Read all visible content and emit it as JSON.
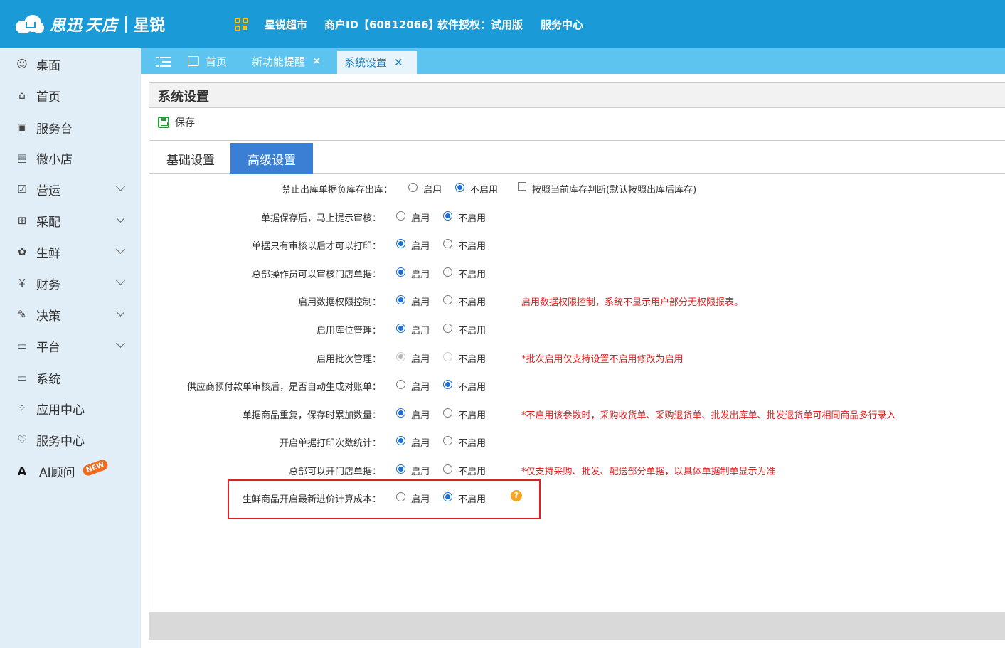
{
  "header": {
    "brand": "思迅",
    "brand_suffix": "天店",
    "product": "星锐",
    "store_name": "星锐超市",
    "merchant_id": "商户ID【60812066】",
    "license": "软件授权：试用版",
    "service": "服务中心",
    "colors": {
      "bar": "#1a9ad6",
      "qr": "#f5c518"
    }
  },
  "sidebar": {
    "items": [
      {
        "label": "桌面",
        "icon": "desktop-icon",
        "glyph": "☺",
        "has_chevron": false
      },
      {
        "label": "首页",
        "icon": "home-store-icon",
        "glyph": "⌂",
        "has_chevron": false
      },
      {
        "label": "服务台",
        "icon": "service-desk-icon",
        "glyph": "▣",
        "has_chevron": false
      },
      {
        "label": "微小店",
        "icon": "mini-store-icon",
        "glyph": "▤",
        "has_chevron": false
      },
      {
        "label": "营运",
        "icon": "operations-icon",
        "glyph": "☑",
        "has_chevron": true
      },
      {
        "label": "采配",
        "icon": "cart-icon",
        "glyph": "⊞",
        "has_chevron": true
      },
      {
        "label": "生鲜",
        "icon": "fresh-icon",
        "glyph": "✿",
        "has_chevron": true
      },
      {
        "label": "财务",
        "icon": "finance-icon",
        "glyph": "¥",
        "has_chevron": true
      },
      {
        "label": "决策",
        "icon": "decision-icon",
        "glyph": "✎",
        "has_chevron": true
      },
      {
        "label": "平台",
        "icon": "platform-icon",
        "glyph": "▭",
        "has_chevron": true
      },
      {
        "label": "系统",
        "icon": "system-icon",
        "glyph": "▭",
        "has_chevron": false
      },
      {
        "label": "应用中心",
        "icon": "app-center-icon",
        "glyph": "⁘",
        "has_chevron": false
      },
      {
        "label": "服务中心",
        "icon": "service-center-icon",
        "glyph": "♡",
        "has_chevron": false
      },
      {
        "label": "AI顾问",
        "icon": "ai-advisor-icon",
        "glyph": "A",
        "has_chevron": false,
        "badge": "NEW"
      }
    ]
  },
  "tabs": [
    {
      "label": "首页",
      "closable": false,
      "active": false
    },
    {
      "label": "新功能提醒",
      "closable": true,
      "active": false
    },
    {
      "label": "系统设置",
      "closable": true,
      "active": true
    }
  ],
  "tab_close_glyph": "✕",
  "page": {
    "title": "系统设置",
    "save_label": "保存",
    "subtabs": [
      {
        "label": "基础设置",
        "active": false
      },
      {
        "label": "高级设置",
        "active": true
      }
    ]
  },
  "options": {
    "enable": "启用",
    "disable": "不启用"
  },
  "settings": [
    {
      "label": "禁止出库单据负库存出库：",
      "value": "disable",
      "extra_checkbox": "按照当前库存判断(默认按照出库后库存)"
    },
    {
      "label": "单据保存后，马上提示审核：",
      "value": "disable"
    },
    {
      "label": "单据只有审核以后才可以打印：",
      "value": "enable"
    },
    {
      "label": "总部操作员可以审核门店单据：",
      "value": "enable"
    },
    {
      "label": "启用数据权限控制：",
      "value": "enable",
      "note": "启用数据权限控制，系统不显示用户部分无权限报表。"
    },
    {
      "label": "启用库位管理：",
      "value": "enable"
    },
    {
      "label": "启用批次管理：",
      "value": "enable",
      "disabled": true,
      "note": "*批次启用仅支持设置不启用修改为启用"
    },
    {
      "label": "供应商预付款单审核后，是否自动生成对账单：",
      "value": "disable"
    },
    {
      "label": "单据商品重复，保存时累加数量：",
      "value": "enable",
      "note": "*不启用该参数时，采购收货单、采购退货单、批发出库单、批发退货单可相同商品多行录入"
    },
    {
      "label": "开启单据打印次数统计：",
      "value": "enable"
    },
    {
      "label": "总部可以开门店单据：",
      "value": "enable",
      "note": "*仅支持采购、批发、配送部分单据，以具体单据制单显示为准"
    },
    {
      "label": "生鲜商品开启最新进价计算成本：",
      "value": "disable",
      "help": "?",
      "highlighted": true
    }
  ]
}
